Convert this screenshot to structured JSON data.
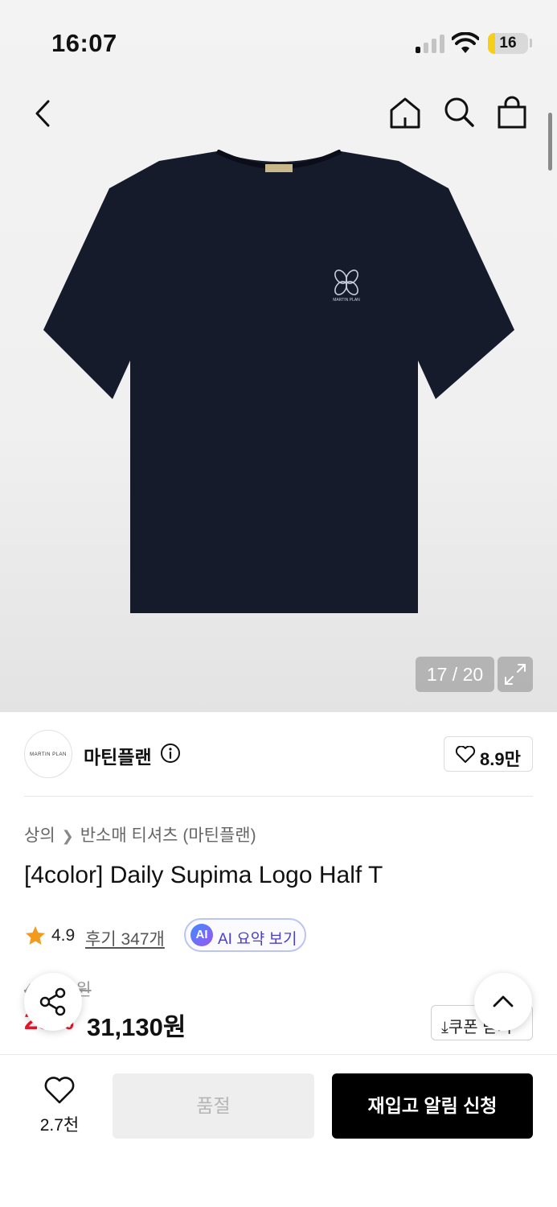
{
  "status_bar": {
    "time": "16:07",
    "battery": "16"
  },
  "nav": {
    "icons": [
      "chevron-left-icon",
      "home-icon",
      "search-icon",
      "shopping-bag-icon"
    ]
  },
  "gallery": {
    "counter": "17 / 20",
    "expand_icon": "expand-icon",
    "product_logo_text": "MARTIN PLAN"
  },
  "brand": {
    "logo_text": "MARTIN PLAN",
    "name": "마틴플랜",
    "likes": "8.9만"
  },
  "breadcrumb": {
    "category": "상의",
    "subcategory": "반소매 티셔츠 (마틴플랜)"
  },
  "product": {
    "title": "[4color] Daily Supima Logo Half T",
    "rating": "4.9",
    "reviews": "후기 347개",
    "ai_badge": "AI",
    "ai_summary": "AI 요약 보기",
    "original_price": "41,500원",
    "discount": "25%",
    "price": "31,130원"
  },
  "coupon": {
    "label": "쿠폰 받기"
  },
  "bottom_bar": {
    "wish_count": "2.7천",
    "soldout_label": "품절",
    "restock_label": "재입고 알림 신청"
  },
  "colors": {
    "accent_red": "#e8172a",
    "star": "#f39a1c",
    "ai_purple": "#4a3fc9",
    "cta_black": "#000000"
  }
}
